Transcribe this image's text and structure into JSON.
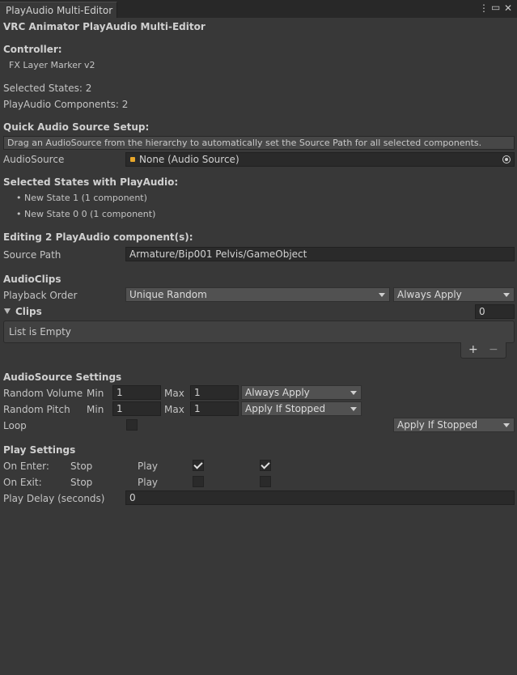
{
  "window": {
    "tab_title": "PlayAudio Multi-Editor",
    "menu_icon": "kebab-menu-icon",
    "maximize_icon": "maximize-icon",
    "close_icon": "close-icon"
  },
  "header": {
    "title": "VRC Animator PlayAudio Multi-Editor"
  },
  "controller": {
    "label": "Controller:",
    "name": "FX Layer Marker v2"
  },
  "stats": {
    "selected_states": "Selected States: 2",
    "playaudio_components": "PlayAudio Components: 2"
  },
  "quick_setup": {
    "title": "Quick Audio Source Setup:",
    "help": "Drag an AudioSource from the hierarchy to automatically set the Source Path for all selected components.",
    "field_label": "AudioSource",
    "field_value": "None (Audio Source)"
  },
  "selected_states": {
    "title": "Selected States with PlayAudio:",
    "items": [
      "• New State 1 (1 component)",
      "• New State 0 0 (1 component)"
    ]
  },
  "editing": {
    "title": "Editing 2 PlayAudio component(s):",
    "source_path_label": "Source Path",
    "source_path_value": "Armature/Bip001 Pelvis/GameObject"
  },
  "audioclips": {
    "title": "AudioClips",
    "playback_order_label": "Playback Order",
    "playback_order_value": "Unique Random",
    "playback_apply_value": "Always Apply",
    "clips_label": "Clips",
    "clips_count": "0",
    "list_empty": "List is Empty",
    "add_label": "+",
    "remove_label": "−"
  },
  "audiosource_settings": {
    "title": "AudioSource Settings",
    "min_label": "Min",
    "max_label": "Max",
    "volume_label": "Random Volume",
    "volume_min": "1",
    "volume_max": "1",
    "volume_apply": "Always Apply",
    "pitch_label": "Random Pitch",
    "pitch_min": "1",
    "pitch_max": "1",
    "pitch_apply": "Apply If Stopped",
    "loop_label": "Loop",
    "loop_checked": false,
    "loop_apply": "Apply If Stopped"
  },
  "play_settings": {
    "title": "Play Settings",
    "on_enter_label": "On Enter:",
    "on_exit_label": "On Exit:",
    "stop_label": "Stop",
    "play_label": "Play",
    "on_enter_stop": true,
    "on_enter_play": true,
    "on_exit_stop": false,
    "on_exit_play": false,
    "delay_label": "Play Delay (seconds)",
    "delay_value": "0"
  }
}
